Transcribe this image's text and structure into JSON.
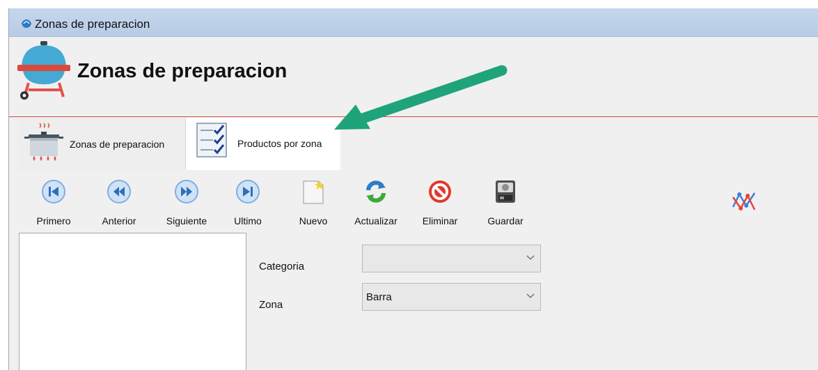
{
  "window": {
    "title": "Zonas de preparacion"
  },
  "header": {
    "title": "Zonas de preparacion",
    "line_color": "#d24a4a"
  },
  "tabs": [
    {
      "label": "Zonas de preparacion",
      "selected": false,
      "icon": "pot-icon"
    },
    {
      "label": "Productos por zona",
      "selected": true,
      "icon": "checklist-icon"
    }
  ],
  "toolbar": {
    "buttons": [
      {
        "label": "Primero",
        "icon": "first-record-icon"
      },
      {
        "label": "Anterior",
        "icon": "previous-record-icon"
      },
      {
        "label": "Siguiente",
        "icon": "next-record-icon"
      },
      {
        "label": "Ultimo",
        "icon": "last-record-icon"
      },
      {
        "label": "Nuevo",
        "icon": "new-document-icon"
      },
      {
        "label": "Actualizar",
        "icon": "refresh-icon"
      },
      {
        "label": "Eliminar",
        "icon": "delete-icon"
      },
      {
        "label": "Guardar",
        "icon": "save-icon"
      }
    ]
  },
  "form": {
    "categoria": {
      "label": "Categoria",
      "value": ""
    },
    "zona": {
      "label": "Zona",
      "value": "Barra"
    }
  },
  "annotation": {
    "color": "#1fa37b",
    "icon": "arrow-annotation"
  }
}
